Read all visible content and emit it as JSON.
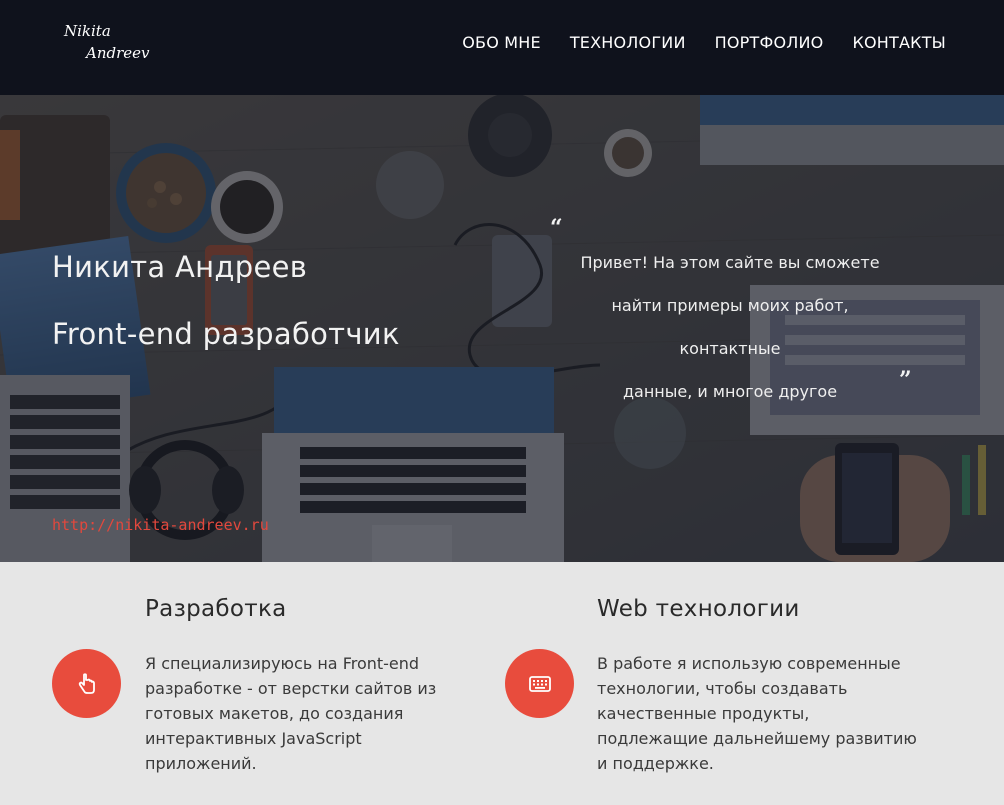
{
  "logo": {
    "line1": "Nikita",
    "line2": "Andreev"
  },
  "nav": {
    "items": [
      {
        "label": "ОБО МНЕ"
      },
      {
        "label": "ТЕХНОЛОГИИ"
      },
      {
        "label": "ПОРТФОЛИО"
      },
      {
        "label": "КОНТАКТЫ"
      }
    ]
  },
  "hero": {
    "name": "Никита Андреев",
    "role": "Front-end разработчик",
    "quote_open": "“",
    "quote_lines": [
      "Привет! На этом сайте вы сможете",
      "найти примеры моих работ, контактные",
      "данные, и многое другое"
    ],
    "quote_close": "”",
    "link": "http://nikita-andreev.ru"
  },
  "services": [
    {
      "title": "Разработка",
      "icon": "hand-pointer-icon",
      "text_lines": [
        "Я специализируюсь на Front-end",
        "разработке - от верстки сайтов из",
        "готовых макетов, до создания",
        "интерактивных JavaScript",
        "приложений."
      ]
    },
    {
      "title": "Web технологии",
      "icon": "keyboard-icon",
      "text_lines": [
        "В работе я использую современные",
        "технологии, чтобы создавать",
        "качественные продукты,",
        "подлежащие дальнейшему развитию",
        "и поддержке."
      ]
    }
  ],
  "colors": {
    "header_bg": "#0f121c",
    "accent": "#e84c3d",
    "link": "#e2483d",
    "services_bg": "#e6e6e6"
  }
}
